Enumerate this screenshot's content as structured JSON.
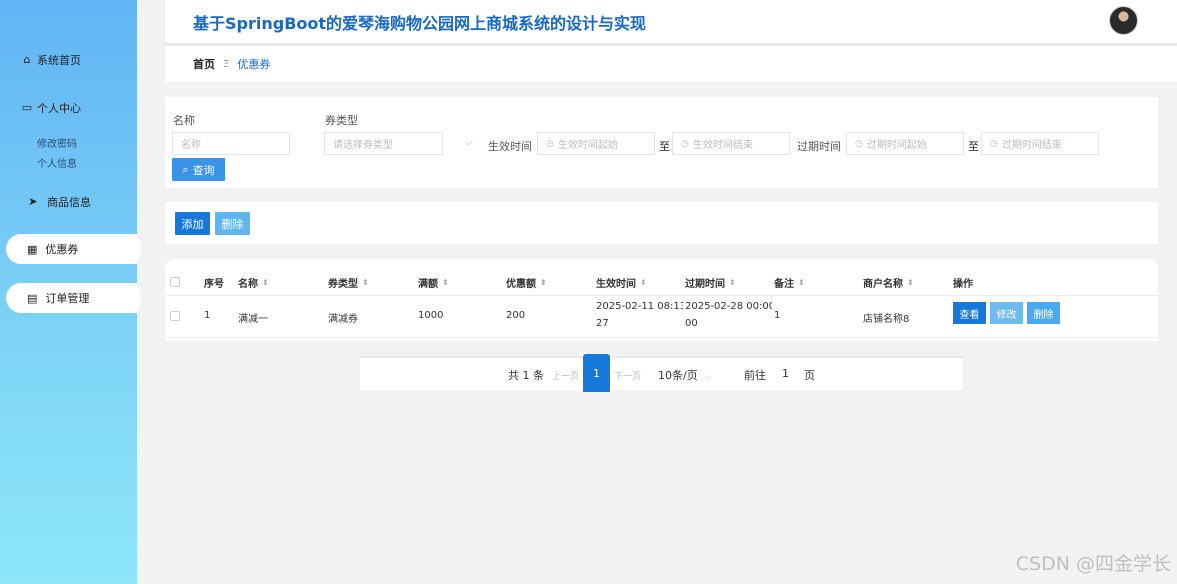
{
  "app": {
    "title": "基于SpringBoot的爱琴海购物公园网上商城系统的设计与实现"
  },
  "sidebar": {
    "items": [
      {
        "label": "系统首页",
        "icon": "home-icon"
      },
      {
        "label": "个人中心",
        "icon": "window-icon"
      },
      {
        "label": "修改密码"
      },
      {
        "label": "个人信息"
      },
      {
        "label": "商品信息",
        "icon": "send-icon"
      },
      {
        "label": "优惠券",
        "icon": "grid-icon"
      },
      {
        "label": "订单管理",
        "icon": "document-icon"
      }
    ]
  },
  "breadcrumb": {
    "home": "首页",
    "separator": "Ξ",
    "current": "优惠券"
  },
  "search": {
    "name_label": "名称",
    "name_placeholder": "名称",
    "type_label": "券类型",
    "type_placeholder": "请选择券类型",
    "effective_label": "生效时间",
    "effective_start_placeholder": "生效时间起始",
    "to_label": "至",
    "effective_end_placeholder": "生效时间结束",
    "expire_label": "过期时间",
    "expire_start_placeholder": "过期时间起始",
    "expire_end_placeholder": "过期时间结束",
    "search_button": "查询"
  },
  "actions": {
    "add": "添加",
    "delete": "删除"
  },
  "table": {
    "headers": [
      "序号",
      "名称",
      "券类型",
      "满额",
      "优惠额",
      "生效时间",
      "过期时间",
      "备注",
      "商户名称",
      "操作"
    ],
    "rows": [
      {
        "index": "1",
        "name": "满减一",
        "type": "满减券",
        "threshold": "1000",
        "discount": "200",
        "effective_time_l1": "2025-02-11 08:13:",
        "effective_time_l2": "27",
        "expire_time_l1": "2025-02-28 00:00:",
        "expire_time_l2": "00",
        "remark": "1",
        "merchant": "店铺名称8",
        "view": "查看",
        "edit": "修改",
        "delete": "删除"
      }
    ]
  },
  "pagination": {
    "total": "共 1 条",
    "prev": "上一页",
    "current_page": "1",
    "next": "下一页",
    "page_size": "10条/页",
    "goto_label": "前往",
    "goto_value": "1",
    "page_unit": "页"
  },
  "watermark": "CSDN @四金学长",
  "colors": {
    "accent": "#1679d9",
    "title": "#1769c2",
    "sidebar_top": "#62b4f5",
    "sidebar_bottom": "#8ee6f8"
  }
}
